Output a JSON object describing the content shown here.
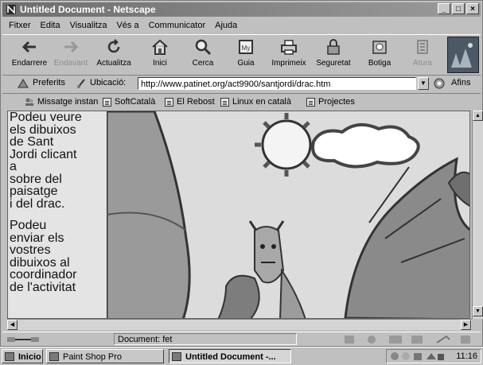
{
  "window": {
    "title": "Untitled Document - Netscape",
    "controls": [
      "minimize",
      "maximize",
      "close"
    ]
  },
  "menu": [
    {
      "label": "Fitxer"
    },
    {
      "label": "Edita"
    },
    {
      "label": "Visualitza"
    },
    {
      "label": "Vés a"
    },
    {
      "label": "Communicator"
    },
    {
      "label": "Ajuda"
    }
  ],
  "toolbar": [
    {
      "label": "Endarrere",
      "icon": "back-arrow-icon",
      "enabled": true
    },
    {
      "label": "Endavant",
      "icon": "forward-arrow-icon",
      "enabled": false
    },
    {
      "label": "Actualitza",
      "icon": "reload-icon",
      "enabled": true
    },
    {
      "label": "Inici",
      "icon": "home-icon",
      "enabled": true
    },
    {
      "label": "Cerca",
      "icon": "search-icon",
      "enabled": true
    },
    {
      "label": "Guia",
      "icon": "guide-icon",
      "enabled": true
    },
    {
      "label": "Imprimeix",
      "icon": "print-icon",
      "enabled": true
    },
    {
      "label": "Seguretat",
      "icon": "lock-icon",
      "enabled": true
    },
    {
      "label": "Botiga",
      "icon": "shop-icon",
      "enabled": true
    },
    {
      "label": "Atura",
      "icon": "stop-icon",
      "enabled": false
    }
  ],
  "location": {
    "bookmarks_label": "Preferits",
    "label": "Ubicació:",
    "url": "http://www.patinet.org/act9900/santjordi/drac.htm",
    "related_label": "Afins"
  },
  "personal_bar": [
    {
      "label": "Missatge instan"
    },
    {
      "label": "SoftCatalà"
    },
    {
      "label": "El Rebost"
    },
    {
      "label": "Linux en català"
    },
    {
      "label": "Projectes"
    }
  ],
  "page": {
    "paragraph1": "Podeu veure\nels dibuixos\nde Sant\nJordi clicant\na\nsobre del\npaisatge\ni del drac.",
    "paragraph2": "Podeu\nenviar els\nvostres\ndibuixos al\ncoordinador\nde l'activitat"
  },
  "status": {
    "text": "Document: fet"
  },
  "taskbar": {
    "start_label": "Inicio",
    "tasks": [
      {
        "label": "Paint Shop Pro",
        "active": false
      },
      {
        "label": "Untitled Document -...",
        "active": true
      }
    ],
    "clock": "11:16"
  }
}
